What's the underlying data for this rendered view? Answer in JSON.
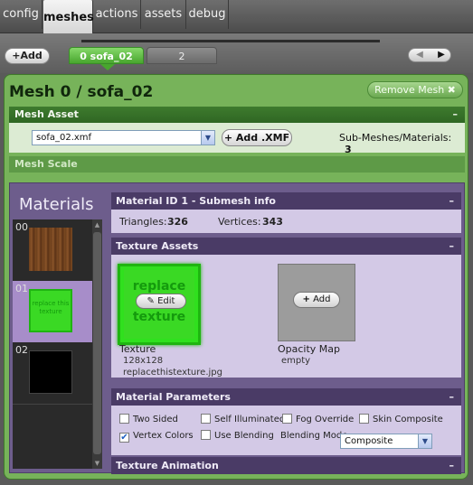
{
  "top_tabs": [
    {
      "label": "config"
    },
    {
      "label": "meshes"
    },
    {
      "label": "actions"
    },
    {
      "label": "assets"
    },
    {
      "label": "debug"
    }
  ],
  "mesh_bar": {
    "add_label": "+Add",
    "mesh_tabs": [
      {
        "label": "0 sofa_02"
      },
      {
        "label": "2"
      }
    ],
    "nav_prev": "◀",
    "nav_next": "▶"
  },
  "mesh_panel": {
    "title": "Mesh 0 / sofa_02",
    "remove_label": "Remove Mesh ✖",
    "mesh_asset_header": "Mesh Asset",
    "collapse_symbol": "–",
    "asset_file": "sofa_02.xmf",
    "add_xmf_label": "+ Add .XMF",
    "submesh_label": "Sub-Meshes/Materials:",
    "submesh_count": "3",
    "mesh_scale_header": "Mesh Scale"
  },
  "materials": {
    "title": "Materials",
    "items": [
      {
        "num": "00"
      },
      {
        "num": "01"
      },
      {
        "num": "02"
      }
    ],
    "selected_thumb_text": "replace this texture"
  },
  "material_info": {
    "header": "Material ID 1 - Submesh info",
    "triangles_label": "Triangles:",
    "triangles": "326",
    "vertices_label": "Vertices:",
    "vertices": "343"
  },
  "texture_assets": {
    "header": "Texture Assets",
    "texture": {
      "image_text_line1": "replace",
      "image_text_line2": "texture",
      "edit_label": "Edit",
      "label": "Texture",
      "size": "128x128",
      "file": "replacethistexture.jpg"
    },
    "opacity": {
      "add_label": "Add",
      "label": "Opacity Map",
      "value": "empty"
    }
  },
  "material_params": {
    "header": "Material Parameters",
    "options": [
      {
        "label": "Two Sided",
        "checked": false
      },
      {
        "label": "Self Illuminated",
        "checked": false
      },
      {
        "label": "Fog Override",
        "checked": false
      },
      {
        "label": "Skin Composite",
        "checked": false
      },
      {
        "label": "Vertex Colors",
        "checked": true
      },
      {
        "label": "Use Blending",
        "checked": false
      }
    ],
    "blending_mode_label": "Blending Mode",
    "blending_mode_value": "Composite"
  },
  "texture_animation": {
    "header": "Texture Animation"
  },
  "colors": {
    "panel_green": "#77b35a",
    "header_green": "#2f6623",
    "material_purple": "#6d5d8c",
    "texture_green": "#30e01e"
  }
}
